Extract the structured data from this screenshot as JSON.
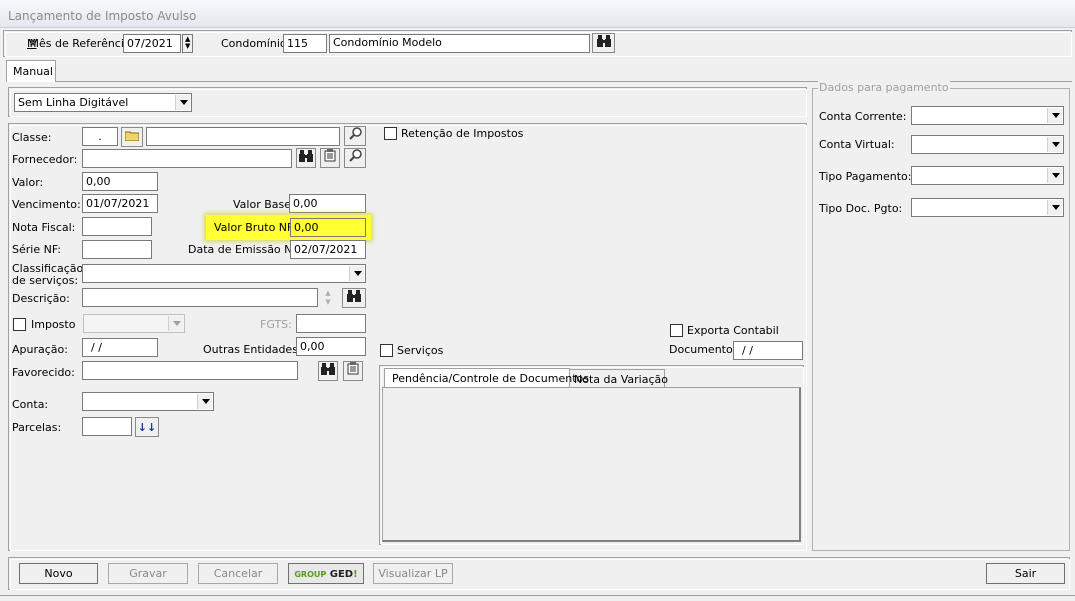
{
  "window": {
    "title": "Lançamento de Imposto Avulso"
  },
  "header": {
    "mes_label": "Mês de Referência:",
    "mes_value": "07/2021",
    "condominio_label": "Condomínio:",
    "condominio_code": "115",
    "condominio_name": "Condomínio Modelo"
  },
  "tabs": {
    "manual": "Manual"
  },
  "linha_digitavel": {
    "value": "Sem Linha Digitável"
  },
  "form": {
    "classe_label": "Classe:",
    "classe_value": ".",
    "fornecedor_label": "Fornecedor:",
    "valor_label": "Valor:",
    "valor_value": "0,00",
    "vencimento_label": "Vencimento:",
    "vencimento_value": "01/07/2021",
    "valor_base_label": "Valor Base:",
    "valor_base_value": "0,00",
    "nota_fiscal_label": "Nota Fiscal:",
    "valor_bruto_label": "Valor Bruto NF:",
    "valor_bruto_value": "0,00",
    "serie_label": "Série NF:",
    "data_emissao_label": "Data de Emissão NF:",
    "data_emissao_value": "02/07/2021",
    "classificacao_label_1": "Classificação",
    "classificacao_label_2": "de serviços:",
    "descricao_label": "Descrição:",
    "imposto_label": "Imposto",
    "fgts_label": "FGTS:",
    "apuracao_label": "Apuração:",
    "apuracao_value": " / /",
    "outras_label": "Outras Entidades:",
    "outras_value": "0,00",
    "favorecido_label": "Favorecido:",
    "conta_label": "Conta:",
    "parcelas_label": "Parcelas:"
  },
  "middle": {
    "retencao_label": "Retenção de Impostos",
    "exporta_label": "Exporta Contabil",
    "documento_label": "Documento:",
    "documento_value": " / /",
    "servicos_label": "Serviços",
    "tab_pendencia": "Pendência/Controle de Documentos",
    "tab_nota": "Nota da Variação"
  },
  "pagamento": {
    "group_title": "Dados para pagamento",
    "conta_corrente_label": "Conta Corrente:",
    "conta_virtual_label": "Conta Virtual:",
    "tipo_pagamento_label": "Tipo Pagamento:",
    "tipo_doc_label": "Tipo Doc. Pgto:"
  },
  "footer": {
    "novo": "Novo",
    "gravar": "Gravar",
    "cancelar": "Cancelar",
    "ged_group": "GROUP",
    "ged_ged": "GED",
    "ged_bang": "!",
    "visualizar": "Visualizar LP",
    "sair": "Sair"
  },
  "icons": {
    "binoculars": "binoculars-icon",
    "folder": "folder-icon",
    "magnifier": "magnifier-icon",
    "notepad": "notepad-icon",
    "spin": "spin-icon",
    "down_arrows": "down-arrows-icon"
  },
  "colors": {
    "highlight": "#ffff33",
    "ged_green": "#5a9a1e",
    "title_text": "#8a8a8a"
  }
}
